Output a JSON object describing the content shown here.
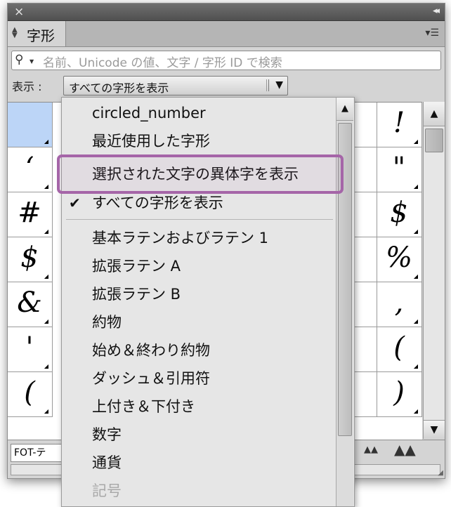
{
  "panel": {
    "title": "字形",
    "close_icon": "×",
    "collapse_icon": "◂◂",
    "menu_icon": "▾☰"
  },
  "search": {
    "placeholder": "名前、Unicode の値、文字 / 字形 ID で検索"
  },
  "show": {
    "label": "表示 :",
    "selected": "すべての字形を表示"
  },
  "grid": {
    "left_column": [
      "",
      "‘",
      "#",
      "$",
      "&",
      "'",
      "("
    ],
    "right_column": [
      "!",
      "\"",
      "$",
      "%",
      ",",
      "(",
      ")"
    ]
  },
  "dropdown": {
    "items": [
      {
        "label": "circled_number"
      },
      {
        "label": "最近使用した字形"
      },
      {
        "label": "選択された文字の異体字を表示"
      },
      {
        "label": "すべての字形を表示",
        "checked": true
      },
      {
        "label": "基本ラテンおよびラテン 1"
      },
      {
        "label": "拡張ラテン A"
      },
      {
        "label": "拡張ラテン B"
      },
      {
        "label": "約物"
      },
      {
        "label": "始め＆終わり約物"
      },
      {
        "label": "ダッシュ＆引用符"
      },
      {
        "label": "上付き＆下付き"
      },
      {
        "label": "数字"
      },
      {
        "label": "通貨"
      },
      {
        "label": "記号",
        "disabled": true
      }
    ],
    "highlighted": "選択された文字の異体字を表示"
  },
  "bottom": {
    "font_name": "FOT-テ"
  },
  "colors": {
    "highlight": "#a565a8",
    "selected_cell": "#bcd5f7"
  }
}
